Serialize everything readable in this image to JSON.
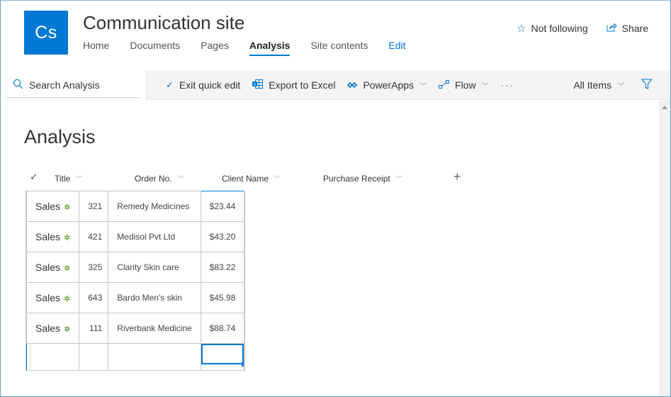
{
  "site": {
    "logo_initials": "Cs",
    "title": "Communication site",
    "brand_color": "#0078d4"
  },
  "nav": {
    "items": [
      {
        "label": "Home",
        "active": false
      },
      {
        "label": "Documents",
        "active": false
      },
      {
        "label": "Pages",
        "active": false
      },
      {
        "label": "Analysis",
        "active": true
      },
      {
        "label": "Site contents",
        "active": false
      },
      {
        "label": "Edit",
        "active": false
      }
    ]
  },
  "header_actions": {
    "follow_label": "Not following",
    "follow_icon": "star-outline-icon",
    "share_label": "Share",
    "share_icon": "share-icon"
  },
  "search": {
    "placeholder": "Search Analysis",
    "icon": "search-icon"
  },
  "commandbar": {
    "exit_quick_edit": "Exit quick edit",
    "export_excel": "Export to Excel",
    "powerapps": "PowerApps",
    "flow": "Flow",
    "more": "···",
    "view": "All Items"
  },
  "page": {
    "title": "Analysis"
  },
  "list": {
    "columns": [
      "Title",
      "Order No.",
      "Client Name",
      "Purchase Receipt"
    ],
    "add_column_label": "+",
    "new_badge_glyph": "✲",
    "rows": [
      {
        "title": "Sales",
        "order_no": "321",
        "client_name": "Remedy Medicines",
        "purchase_receipt": "$23.44"
      },
      {
        "title": "Sales",
        "order_no": "421",
        "client_name": "Medisol Pvt Ltd",
        "purchase_receipt": "$43.20"
      },
      {
        "title": "Sales",
        "order_no": "325",
        "client_name": "Clarity Skin care",
        "purchase_receipt": "$83.22"
      },
      {
        "title": "Sales",
        "order_no": "643",
        "client_name": "Bardo Men's skin",
        "purchase_receipt": "$45.98"
      },
      {
        "title": "Sales",
        "order_no": "111",
        "client_name": "Riverbank Medicine",
        "purchase_receipt": "$88.74"
      }
    ]
  }
}
